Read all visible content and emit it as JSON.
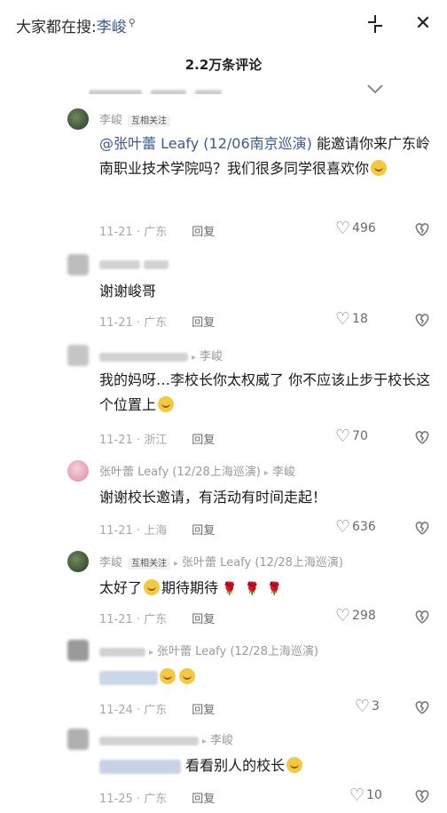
{
  "header": {
    "search_prefix": "大家都在搜:",
    "search_keyword": "李峻",
    "comment_count": "2.2万条评论"
  },
  "partial_row": {
    "reply": "回复"
  },
  "comments": [
    {
      "name": "李峻",
      "tag": "互相关注",
      "text_mention": "@张叶蕾 Leafy (12/06南京巡演)",
      "text": " 能邀请你来广东岭南职业技术学院吗？我们很多同学很喜欢你",
      "date": "11-21",
      "location": "广东",
      "reply": "回复",
      "likes": "496"
    },
    {
      "text": "谢谢峻哥",
      "date": "11-21",
      "location": "广东",
      "reply": "回复",
      "likes": "18"
    },
    {
      "reply_to": "李峻",
      "text": "我的妈呀…李校长你太权威了 你不应该止步于校长这个位置上",
      "date": "11-21",
      "location": "浙江",
      "reply": "回复",
      "likes": "70"
    },
    {
      "name": "张叶蕾 Leafy (12/28上海巡演)",
      "reply_to": "李峻",
      "text": "谢谢校长邀请，有活动有时间走起！",
      "date": "11-21",
      "location": "上海",
      "reply": "回复",
      "likes": "636"
    },
    {
      "name": "李峻",
      "tag": "互相关注",
      "reply_to": "张叶蕾 Leafy (12/28上海巡演)",
      "text": "太好了",
      "text_after_emoji": "期待期待",
      "date": "11-21",
      "location": "广东",
      "reply": "回复",
      "likes": "298"
    },
    {
      "reply_to": "张叶蕾 Leafy (12/28上海巡演)",
      "date": "11-24",
      "location": "广东",
      "reply": "回复",
      "likes": "3"
    },
    {
      "reply_to": "李峻",
      "text": "看看别人的校长",
      "date": "11-25",
      "location": "广东",
      "reply": "回复",
      "likes": "10"
    }
  ],
  "icons": {
    "collapse": "collapse-icon",
    "close": "close-icon",
    "like": "heart-outline-icon",
    "dislike": "broken-heart-icon",
    "search": "search-icon"
  },
  "colors": {
    "link": "#3a5a8c",
    "meta": "#a8a8a8",
    "rose": "#e0325a",
    "emoji": "#f5c842"
  }
}
